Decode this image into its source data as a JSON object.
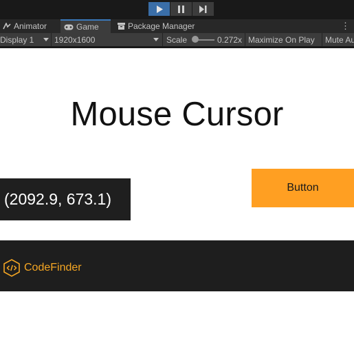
{
  "playbar": {
    "buttons": [
      {
        "name": "play",
        "icon": "play-icon",
        "active": true
      },
      {
        "name": "pause",
        "icon": "pause-icon",
        "active": false
      },
      {
        "name": "step",
        "icon": "step-icon",
        "active": false
      }
    ]
  },
  "tabs": [
    {
      "label": "Animator",
      "icon": "animator-icon",
      "active": false
    },
    {
      "label": "Game",
      "icon": "gamepad-icon",
      "active": true
    },
    {
      "label": "Package Manager",
      "icon": "package-icon",
      "active": false
    }
  ],
  "toolbar": {
    "display": "Display 1",
    "resolution": "1920x1600",
    "scale_label": "Scale",
    "scale_value": "0.272x",
    "maximize": "Maximize On Play",
    "mute": "Mute Audio"
  },
  "game": {
    "title": "Mouse Cursor",
    "coords": "(2092.9, 673.1)",
    "button_label": "Button",
    "logo_text": "CodeFinder"
  },
  "colors": {
    "accent_orange": "#ff9f22",
    "logo_orange": "#f5a623",
    "editor_dark": "#191919",
    "play_active": "#3a6ea8"
  }
}
